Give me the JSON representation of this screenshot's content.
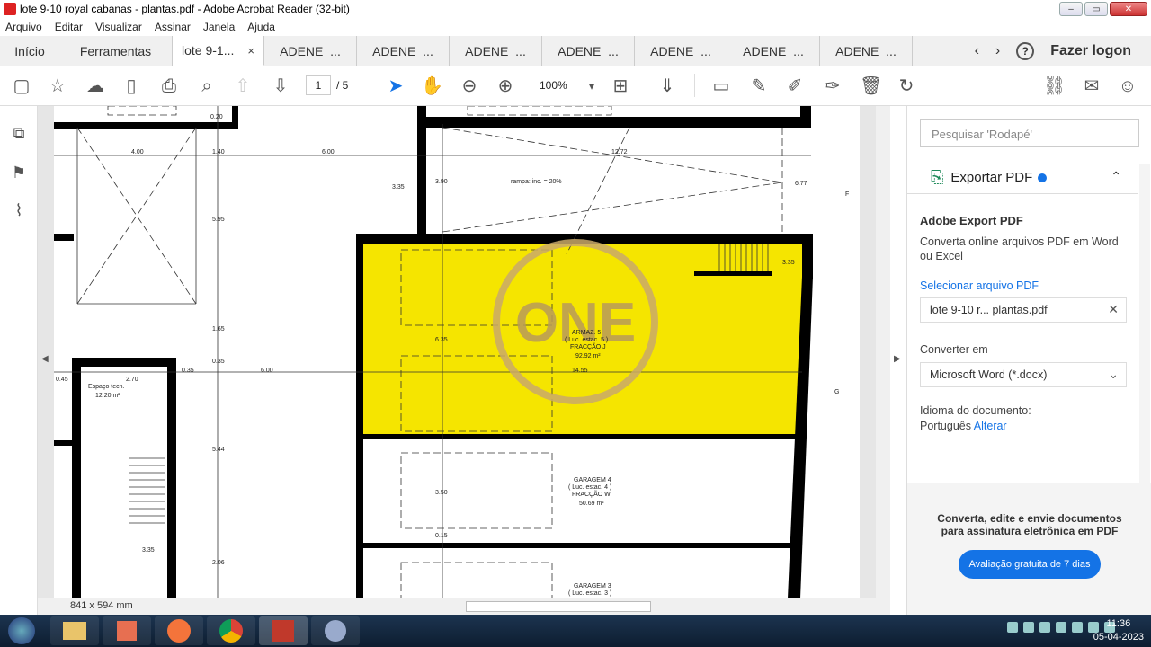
{
  "window": {
    "title": "lote 9-10 royal cabanas - plantas.pdf - Adobe Acrobat Reader (32-bit)"
  },
  "menu": [
    "Arquivo",
    "Editar",
    "Visualizar",
    "Assinar",
    "Janela",
    "Ajuda"
  ],
  "tabs": {
    "home": "Início",
    "tools": "Ferramentas",
    "active": "lote 9-1...",
    "close": "×",
    "docs": [
      "ADENE_...",
      "ADENE_...",
      "ADENE_...",
      "ADENE_...",
      "ADENE_...",
      "ADENE_...",
      "ADENE_..."
    ],
    "prev": "‹",
    "next": "›",
    "help": "?",
    "login": "Fazer logon"
  },
  "toolbar": {
    "page_current": "1",
    "page_total": "/ 5",
    "zoom": "100%"
  },
  "viewer": {
    "page_size": "841 x 594 mm"
  },
  "plan": {
    "dims": [
      "4.00",
      "1.40",
      "6.00",
      "12.72",
      "0.20",
      "3.90",
      "3.35",
      "6.77",
      "5.95",
      "1.65",
      "0.35",
      "6.35",
      "0.45",
      "2.70",
      "0.35",
      "6.00",
      "14.55",
      "5.44",
      "3.50",
      "0.15",
      "2.06",
      "3.35",
      "3.35"
    ],
    "rampa": "rampa: inc. = 20%",
    "espaco": "Espaço tecn.",
    "espaco_area": "12.20 m²",
    "garagem_top": [
      "ARMAZ. 5",
      "( Luc. estac. 5 )",
      "FRACÇÃO J",
      "92.92 m²"
    ],
    "garagem4": [
      "GARAGEM 4",
      "( Luc. estac. 4 )",
      "FRACÇÃO W",
      "50.69 m²"
    ],
    "garagem3": [
      "GARAGEM 3",
      "( Luc. estac. 3 )"
    ],
    "markers": [
      "F",
      "G"
    ],
    "watermark": "ONE"
  },
  "panel": {
    "search_placeholder": "Pesquisar 'Rodapé'",
    "export_title": "Exportar PDF",
    "heading": "Adobe Export PDF",
    "desc": "Converta online arquivos PDF em Word ou Excel",
    "select_link": "Selecionar arquivo PDF",
    "file": "lote 9-10 r... plantas.pdf",
    "convert_label": "Converter em",
    "format": "Microsoft Word (*.docx)",
    "lang_label": "Idioma do documento:",
    "lang": "Português",
    "lang_change": "Alterar",
    "promo": "Converta, edite e envie documentos para assinatura eletrônica em PDF",
    "trial": "Avaliação gratuita de 7 dias"
  },
  "taskbar": {
    "time": "11:36",
    "date": "05-04-2023"
  },
  "colors": {
    "accent": "#1473e6",
    "highlight": "#f5e500"
  }
}
